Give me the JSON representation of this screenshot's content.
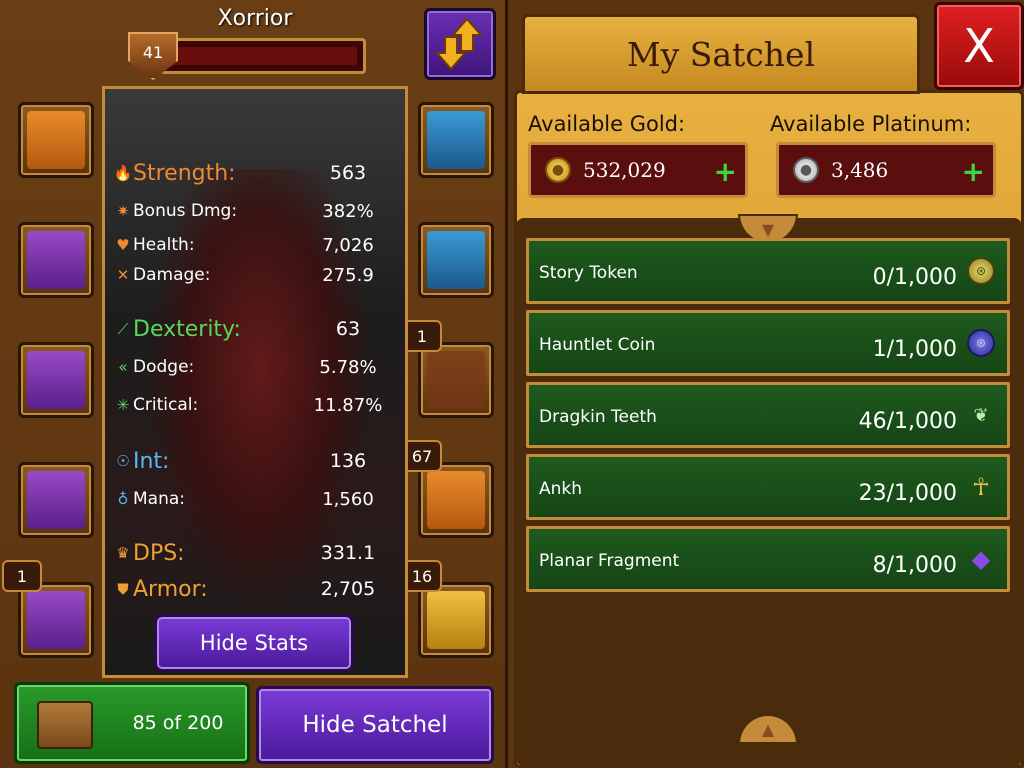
{
  "character": {
    "name": "Xorrior",
    "level": "41",
    "xp_fraction": 1.0
  },
  "stats": [
    {
      "icon": "strength-icon",
      "glyph": "🔥",
      "label": "Strength:",
      "value": "563",
      "size": "big",
      "color": "#f08a30"
    },
    {
      "icon": "bonus-damage-icon",
      "glyph": "✷",
      "label": "Bonus Dmg:",
      "value": "382%",
      "size": "small",
      "color": "#f08a30"
    },
    {
      "icon": "health-icon",
      "glyph": "♥",
      "label": "Health:",
      "value": "7,026",
      "size": "small",
      "color": "#f08a30"
    },
    {
      "icon": "damage-icon",
      "glyph": "✕",
      "label": "Damage:",
      "value": "275.9",
      "size": "small",
      "color": "#f08a30"
    },
    {
      "icon": "dexterity-icon",
      "glyph": "⟋",
      "label": "Dexterity:",
      "value": "63",
      "size": "big",
      "color": "#5ad85a"
    },
    {
      "icon": "dodge-icon",
      "glyph": "«",
      "label": "Dodge:",
      "value": "5.78%",
      "size": "small",
      "color": "#5ad85a"
    },
    {
      "icon": "critical-icon",
      "glyph": "✳",
      "label": "Critical:",
      "value": "11.87%",
      "size": "small",
      "color": "#5ad85a"
    },
    {
      "icon": "int-icon",
      "glyph": "☉",
      "label": "Int:",
      "value": "136",
      "size": "big",
      "color": "#5ab8f0"
    },
    {
      "icon": "mana-icon",
      "glyph": "♁",
      "label": "Mana:",
      "value": "1,560",
      "size": "small",
      "color": "#5ab8f0"
    },
    {
      "icon": "dps-icon",
      "glyph": "♛",
      "label": "DPS:",
      "value": "331.1",
      "size": "big",
      "color": "#f0a030"
    },
    {
      "icon": "armor-icon",
      "glyph": "⛊",
      "label": "Armor:",
      "value": "2,705",
      "size": "big",
      "color": "#f0a030"
    }
  ],
  "buttons": {
    "hide_stats": "Hide Stats",
    "hide_satchel": "Hide Satchel",
    "close": "X"
  },
  "inventory": {
    "count": "85 of 200"
  },
  "slot_badges": {
    "ring_slot": "1",
    "banner_slot": "1",
    "anvil_slot": "67",
    "chest_slot": "16"
  },
  "satchel": {
    "title": "My Satchel",
    "gold_label": "Available Gold:",
    "gold_value": "532,029",
    "platinum_label": "Available Platinum:",
    "platinum_value": "3,486",
    "items": [
      {
        "name": "Story Token",
        "count": "0/1,000",
        "icon": "story-token-icon",
        "glyph": "⊛",
        "cls": "ic-token"
      },
      {
        "name": "Hauntlet Coin",
        "count": "1/1,000",
        "icon": "hauntlet-coin-icon",
        "glyph": "⊛",
        "cls": "ic-coin"
      },
      {
        "name": "Dragkin Teeth",
        "count": "46/1,000",
        "icon": "dragkin-teeth-icon",
        "glyph": "❦",
        "cls": "ic-teeth"
      },
      {
        "name": "Ankh",
        "count": "23/1,000",
        "icon": "ankh-icon",
        "glyph": "☥",
        "cls": "ic-ankh"
      },
      {
        "name": "Planar Fragment",
        "count": "8/1,000",
        "icon": "planar-fragment-icon",
        "glyph": "◆",
        "cls": "ic-fragment"
      }
    ]
  },
  "colors": {
    "panel_brown": "#5a3410",
    "satchel_gold": "#e8b040",
    "item_green": "#1e5a1e",
    "button_purple": "#7a3ad8",
    "close_red": "#e02020"
  }
}
